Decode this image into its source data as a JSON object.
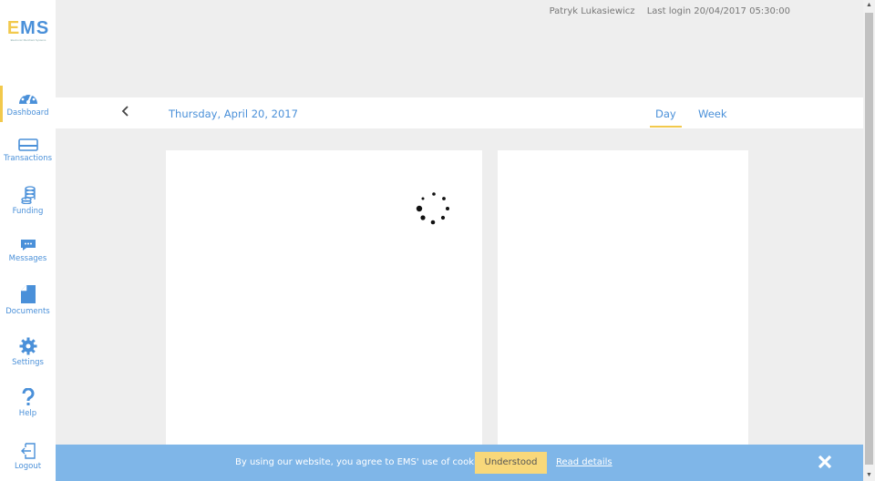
{
  "app": {
    "logo_text": "EMS",
    "logo_sub": "Electronic Merchant Systems"
  },
  "header": {
    "user_name": "Patryk Lukasiewicz",
    "last_login": "Last login 20/04/2017 05:30:00"
  },
  "sidebar": {
    "items": [
      {
        "label": "Dashboard",
        "icon": "dashboard-gauge-icon"
      },
      {
        "label": "Transactions",
        "icon": "credit-card-icon"
      },
      {
        "label": "Funding",
        "icon": "coin-stack-icon"
      },
      {
        "label": "Messages",
        "icon": "chat-bubble-icon"
      },
      {
        "label": "Documents",
        "icon": "document-icon"
      },
      {
        "label": "Settings",
        "icon": "gear-icon"
      },
      {
        "label": "Help",
        "icon": "question-mark-icon"
      },
      {
        "label": "Logout",
        "icon": "logout-icon"
      }
    ]
  },
  "datebar": {
    "date": "Thursday, April 20, 2017",
    "tabs": [
      "Day",
      "Week"
    ],
    "active_tab": "Day"
  },
  "cookie": {
    "text": "By using our website, you agree to EMS' use of cookies.",
    "button": "Understood",
    "link": "Read details",
    "close": "✕"
  },
  "colors": {
    "accent": "#4a90d9",
    "highlight": "#f2c94c",
    "cookie_bar": "#7fb6e8"
  }
}
